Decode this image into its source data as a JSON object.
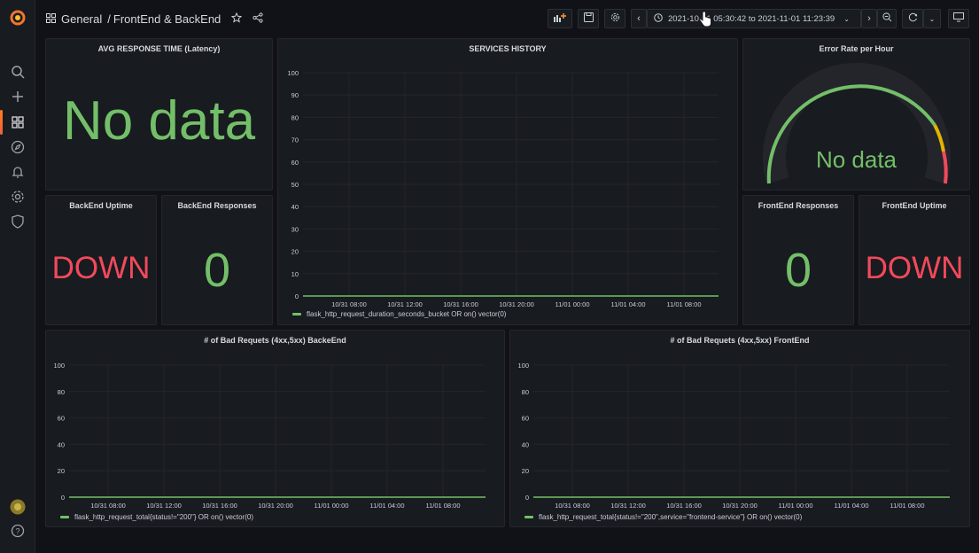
{
  "topbar": {
    "breadcrumb_folder": "General",
    "breadcrumb_sep": "/",
    "breadcrumb_title": "FrontEnd & BackEnd",
    "time_range": "2021-10-31 05:30:42 to 2021-11-01 11:23:39"
  },
  "panels": {
    "latency": {
      "title": "AVG RESPONSE TIME (Latency)",
      "value": "No data"
    },
    "history": {
      "title": "SERVICES HISTORY",
      "legend": "flask_http_request_duration_seconds_bucket OR on() vector(0)"
    },
    "error_rate": {
      "title": "Error Rate per Hour",
      "value": "No data"
    },
    "backend_uptime": {
      "title": "BackEnd Uptime",
      "value": "DOWN"
    },
    "backend_responses": {
      "title": "BackEnd Responses",
      "value": "0"
    },
    "frontend_responses": {
      "title": "FrontEnd Responses",
      "value": "0"
    },
    "frontend_uptime": {
      "title": "FrontEnd Uptime",
      "value": "DOWN"
    },
    "bad_backend": {
      "title": "# of Bad Requets (4xx,5xx) BackeEnd",
      "legend": "flask_http_request_total{status!=\"200\"} OR on() vector(0)"
    },
    "bad_frontend": {
      "title": "# of Bad Requets (4xx,5xx) FrontEnd",
      "legend": "flask_http_request_total{status!=\"200\",service=\"frontend-service\"} OR on() vector(0)"
    }
  },
  "colors": {
    "ok": "#73bf69",
    "down": "#f2495c",
    "warn": "#e0b400"
  },
  "chart_data": [
    {
      "id": "history",
      "type": "line",
      "x": [
        "10/31 08:00",
        "10/31 12:00",
        "10/31 16:00",
        "10/31 20:00",
        "11/01 00:00",
        "11/01 04:00",
        "11/01 08:00"
      ],
      "series": [
        {
          "name": "flask_http_request_duration_seconds_bucket OR on() vector(0)",
          "values": [
            0,
            0,
            0,
            0,
            0,
            0,
            0
          ]
        }
      ],
      "yticks": [
        "100",
        "90",
        "80",
        "70",
        "60",
        "50",
        "40",
        "30",
        "20",
        "10",
        "0"
      ],
      "ylim": [
        0,
        100
      ]
    },
    {
      "id": "bad_backend",
      "type": "line",
      "x": [
        "10/31 08:00",
        "10/31 12:00",
        "10/31 16:00",
        "10/31 20:00",
        "11/01 00:00",
        "11/01 04:00",
        "11/01 08:00"
      ],
      "series": [
        {
          "name": "flask_http_request_total{status!=\"200\"} OR on() vector(0)",
          "values": [
            0,
            0,
            0,
            0,
            0,
            0,
            0
          ]
        }
      ],
      "yticks": [
        "100",
        "80",
        "60",
        "40",
        "20",
        "0"
      ],
      "ylim": [
        0,
        100
      ]
    },
    {
      "id": "bad_frontend",
      "type": "line",
      "x": [
        "10/31 08:00",
        "10/31 12:00",
        "10/31 16:00",
        "10/31 20:00",
        "11/01 00:00",
        "11/01 04:00",
        "11/01 08:00"
      ],
      "series": [
        {
          "name": "flask_http_request_total{status!=\"200\",service=\"frontend-service\"} OR on() vector(0)",
          "values": [
            0,
            0,
            0,
            0,
            0,
            0,
            0
          ]
        }
      ],
      "yticks": [
        "100",
        "80",
        "60",
        "40",
        "20",
        "0"
      ],
      "ylim": [
        0,
        100
      ]
    }
  ]
}
